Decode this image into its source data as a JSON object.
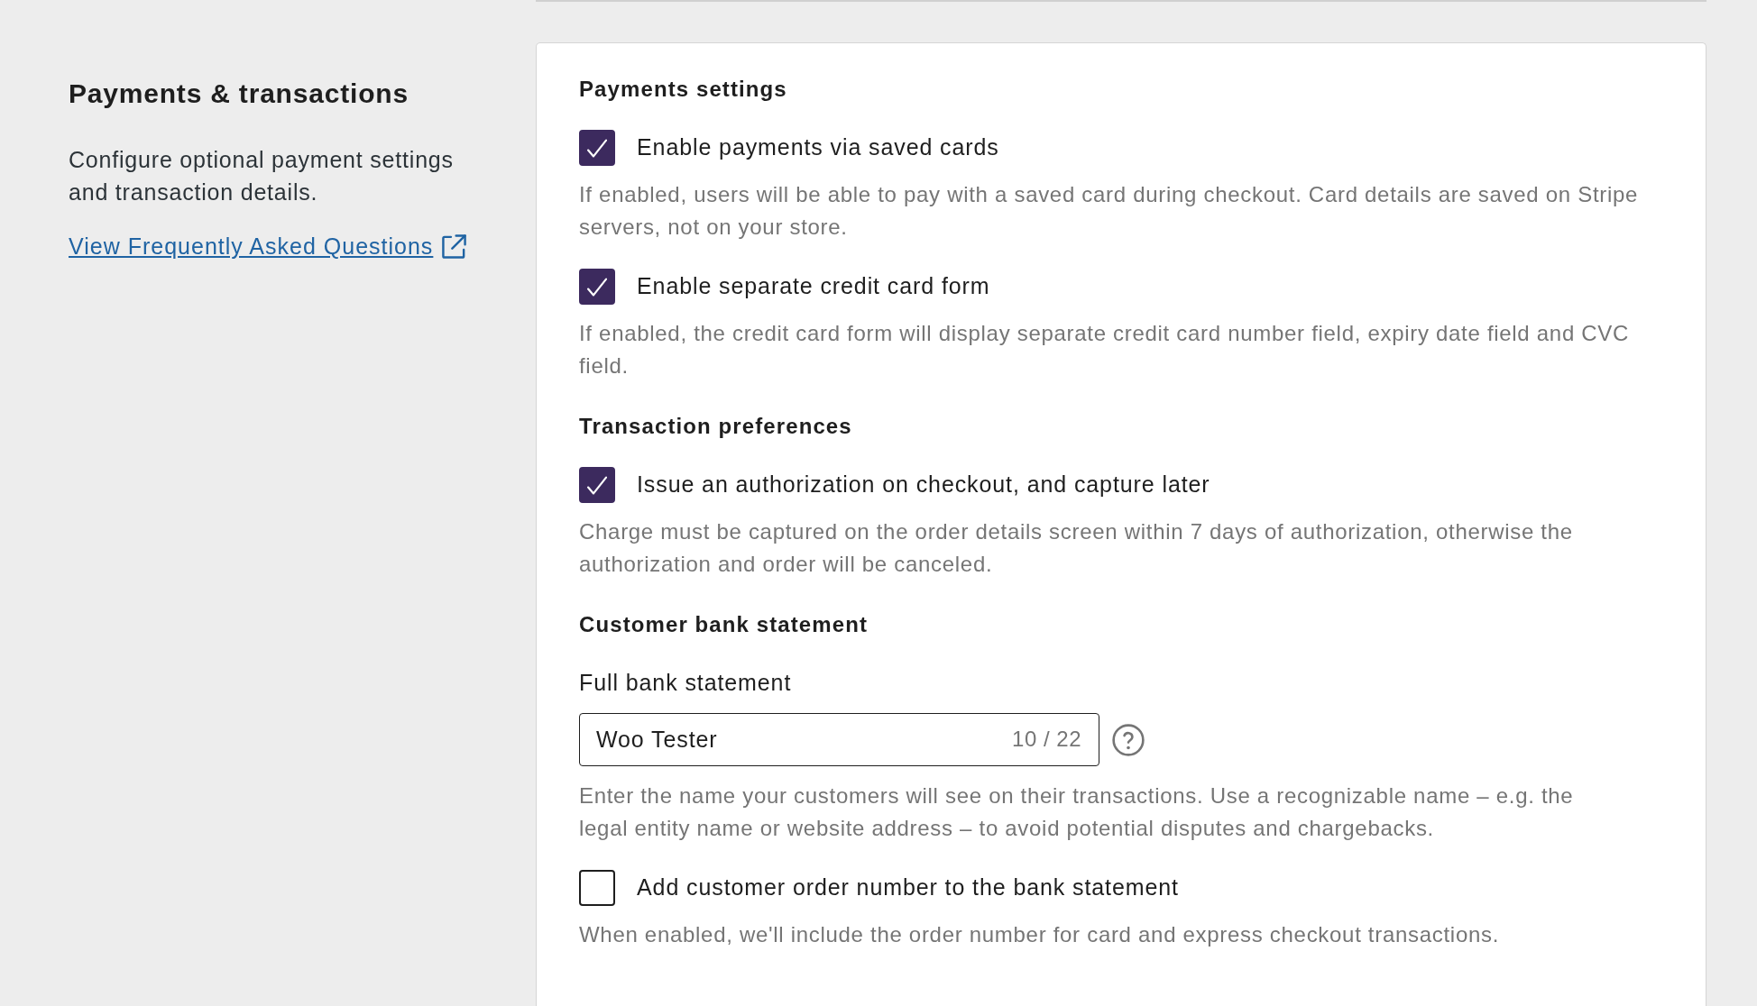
{
  "sidebar": {
    "title": "Payments & transactions",
    "description": "Configure optional payment settings and transaction details.",
    "link": {
      "label": "View Frequently Asked Questions"
    }
  },
  "card": {
    "sections": [
      {
        "title": "Payments settings",
        "items": [
          {
            "kind": "checkbox",
            "label": "Enable payments via saved cards",
            "checked": true,
            "help": "If enabled, users will be able to pay with a saved card during checkout. Card details are saved on Stripe servers, not on your store."
          },
          {
            "kind": "checkbox",
            "label": "Enable separate credit card form",
            "checked": true,
            "help": "If enabled, the credit card form will display separate credit card number field, expiry date field and CVC field."
          }
        ]
      },
      {
        "title": "Transaction preferences",
        "items": [
          {
            "kind": "checkbox",
            "label": "Issue an authorization on checkout, and capture later",
            "checked": true,
            "help": "Charge must be captured on the order details screen within 7 days of authorization, otherwise the authorization and order will be canceled."
          }
        ]
      },
      {
        "title": "Customer bank statement",
        "items": [
          {
            "kind": "text_field",
            "label": "Full bank statement",
            "value": "Woo Tester",
            "counter": "10 / 22",
            "help": "Enter the name your customers will see on their transactions. Use a recognizable name – e.g. the legal entity name or website address – to avoid potential disputes and chargebacks."
          },
          {
            "kind": "checkbox",
            "label": "Add customer order number to the bank statement",
            "checked": false,
            "help": "When enabled, we'll include the order number for card and express checkout transactions."
          }
        ]
      }
    ]
  }
}
